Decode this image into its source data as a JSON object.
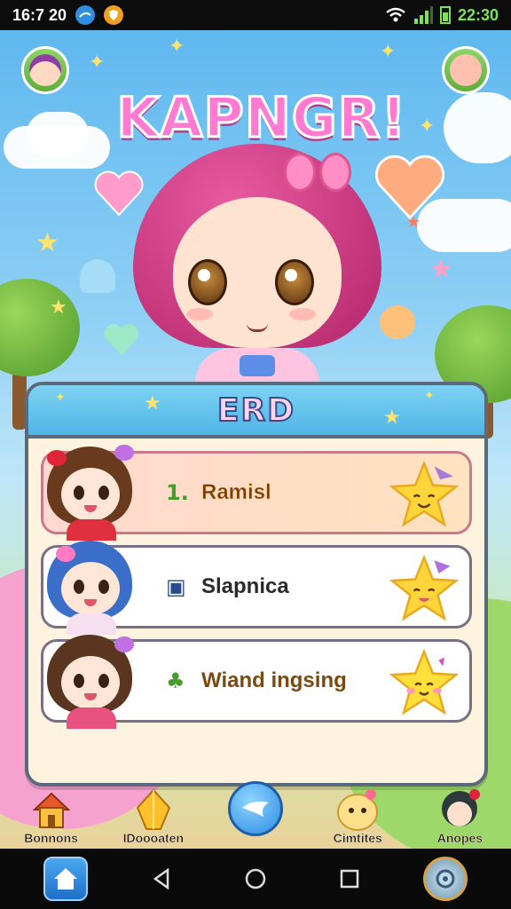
{
  "status_bar": {
    "left_time": "16:7 20",
    "clock": "22:30",
    "icons": [
      "blue-circle-icon",
      "shield-icon",
      "wifi-icon",
      "signal-icon",
      "battery-icon"
    ]
  },
  "game": {
    "title": "KAPNGR!",
    "panel_title": "ERD",
    "leaderboard": [
      {
        "rank_icon": "1.",
        "name": "Ramisl",
        "badge": "star-face-icon",
        "avatar_hair": "#6a3a1e",
        "avatar_bow": "#e0243a",
        "avatar_body": "#e03040"
      },
      {
        "rank_icon": "▣",
        "name": "Slapnica",
        "badge": "star-face-icon",
        "avatar_hair": "#3a6ec8",
        "avatar_bow": "#ff7ac0",
        "avatar_body": "#f6e0f0"
      },
      {
        "rank_icon": "♣",
        "name": "Wiand ingsing",
        "badge": "star-face-icon",
        "avatar_hair": "#5a3620",
        "avatar_bow": "#c070e0",
        "avatar_body": "#e85080"
      }
    ]
  },
  "bottom_nav": [
    {
      "label": "Bonnons",
      "icon": "house-icon"
    },
    {
      "label": "IDoooaten",
      "icon": "crystal-icon"
    },
    {
      "label": "",
      "icon": "play-bird-icon"
    },
    {
      "label": "Cimtites",
      "icon": "chick-icon"
    },
    {
      "label": "Anopes",
      "icon": "friend-avatar-icon"
    }
  ],
  "system_nav": {
    "icons": [
      "home-app-icon",
      "back-icon",
      "home-circle-icon",
      "recents-icon",
      "settings-gear-icon"
    ]
  },
  "colors": {
    "title_pink": "#ff7ad0",
    "panel_bg": "#fdf3df",
    "header_blue": "#4fb5e6",
    "star_yellow": "#ffd53a"
  }
}
